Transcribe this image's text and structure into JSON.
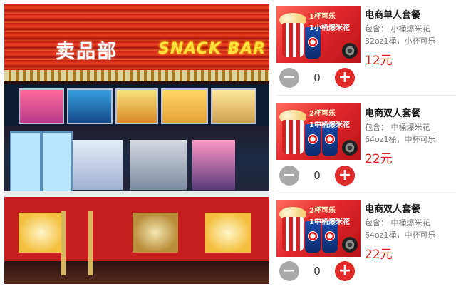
{
  "photo": {
    "sign_cn": "卖品部",
    "sign_en": "SNACK BAR"
  },
  "products": [
    {
      "title": "电商单人套餐",
      "description": "包含： 小桶爆米花32oz1桶，小杯可乐12oz1杯",
      "price": "12元",
      "quantity": "0",
      "thumb_badge_line1": "1杯可乐",
      "thumb_badge_line2": "1小桶爆米花"
    },
    {
      "title": "电商双人套餐",
      "description": "包含： 中桶爆米花64oz1桶，中杯可乐16oz2杯",
      "price": "22元",
      "quantity": "0",
      "thumb_badge_line1": "2杯可乐",
      "thumb_badge_line2": "1中桶爆米花"
    },
    {
      "title": "电商双人套餐",
      "description": "包含： 中桶爆米花64oz1桶，中杯可乐16oz2杯",
      "price": "22元",
      "quantity": "0",
      "thumb_badge_line1": "2杯可乐",
      "thumb_badge_line2": "1中桶爆米花"
    }
  ],
  "icons": {
    "minus": "minus-icon",
    "plus": "plus-icon"
  },
  "colors": {
    "price": "#e0221e",
    "plus_button": "#e22a2a",
    "minus_button": "#a9a9a9"
  }
}
